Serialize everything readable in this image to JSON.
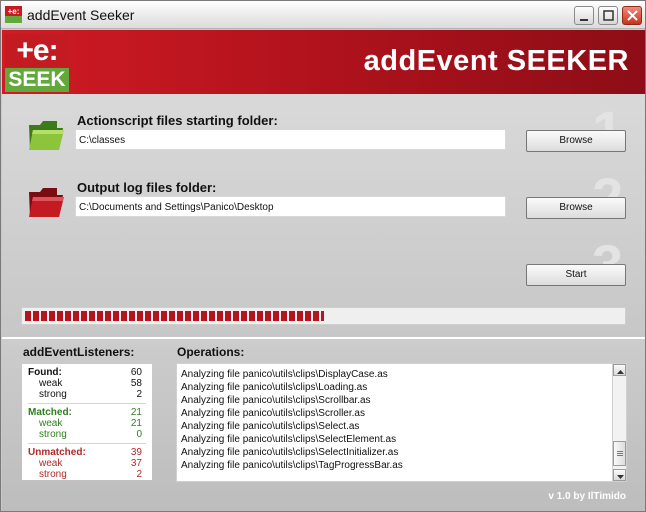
{
  "window": {
    "title": "addEvent Seeker",
    "icon": "seek-logo-icon"
  },
  "header": {
    "logo_top": "+e:",
    "logo_bottom": "SEEK",
    "title": "addEvent SEEKER"
  },
  "steps": {
    "source": {
      "number": "1",
      "label": "Actionscript files starting folder:",
      "value": "C:\\classes",
      "button": "Browse",
      "icon": "green-folder-icon"
    },
    "output": {
      "number": "2",
      "label": "Output log files folder:",
      "value": "C:\\Documents and Settings\\Panico\\Desktop",
      "button": "Browse",
      "icon": "red-folder-icon"
    },
    "start": {
      "number": "3",
      "button": "Start"
    }
  },
  "progress": {
    "fraction": 0.5,
    "segments": 38
  },
  "stats": {
    "label": "addEventListeners:",
    "found": {
      "label": "Found:",
      "value": "60",
      "weak_label": "weak",
      "weak": "58",
      "strong_label": "strong",
      "strong": "2"
    },
    "matched": {
      "label": "Matched:",
      "value": "21",
      "weak_label": "weak",
      "weak": "21",
      "strong_label": "strong",
      "strong": "0"
    },
    "unmatched": {
      "label": "Unmatched:",
      "value": "39",
      "weak_label": "weak",
      "weak": "37",
      "strong_label": "strong",
      "strong": "2"
    }
  },
  "operations": {
    "label": "Operations:",
    "lines": [
      "Analyzing file panico\\utils\\clips\\DisplayCase.as",
      "Analyzing file panico\\utils\\clips\\Loading.as",
      "Analyzing file panico\\utils\\clips\\Scrollbar.as",
      "Analyzing file panico\\utils\\clips\\Scroller.as",
      "Analyzing file panico\\utils\\clips\\Select.as",
      "Analyzing file panico\\utils\\clips\\SelectElement.as",
      "Analyzing file panico\\utils\\clips\\SelectInitializer.as",
      "Analyzing file panico\\utils\\clips\\TagProgressBar.as"
    ]
  },
  "footer": {
    "version": "v 1.0 by IlTimido"
  },
  "colors": {
    "brand_red": "#b3131d",
    "brand_green": "#62a83b",
    "matched": "#2f7f1f",
    "unmatched": "#b02a2a"
  }
}
